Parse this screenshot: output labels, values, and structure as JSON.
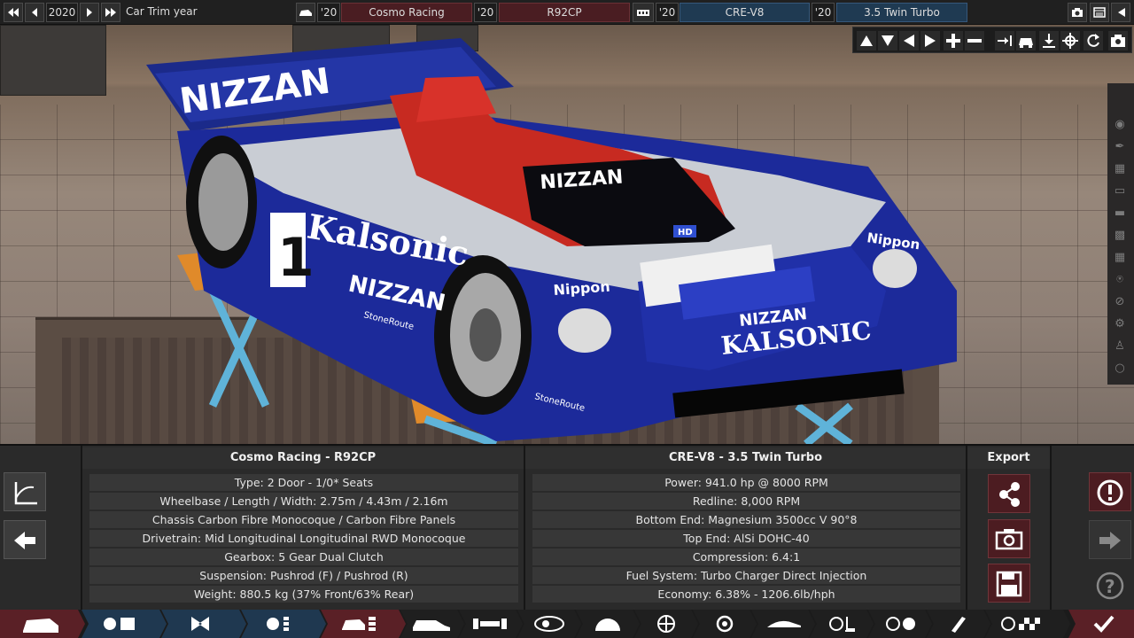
{
  "topbar": {
    "year": "2020",
    "trim_label": "Car Trim year",
    "model_year": "'20",
    "model_name": "Cosmo Racing",
    "trim_year": "'20",
    "trim_name": "R92CP",
    "engine_year": "'20",
    "engine_name": "CRE-V8",
    "variant_year": "'20",
    "variant_name": "3.5 Twin Turbo"
  },
  "car_livery": {
    "wing_text": "NIZZAN",
    "windshield_text": "NIZZAN",
    "sponsor_side": "Kalsonic",
    "brand_side": "NIZZAN",
    "number": "1",
    "brand_nose": "NIZZAN",
    "sponsor_nose": "KALSONIC",
    "tire_left": "Nippon",
    "tire_right": "Nippon",
    "small_1": "StoneRoute",
    "small_2": "StoneRoute",
    "hood_badge": "HD"
  },
  "panel": {
    "car_title": "Cosmo Racing - R92CP",
    "car_specs": [
      "Type: 2 Door - 1/0* Seats",
      "Wheelbase / Length / Width: 2.75m / 4.43m / 2.16m",
      "Chassis Carbon Fibre Monocoque / Carbon Fibre Panels",
      "Drivetrain: Mid Longitudinal Longitudinal RWD Monocoque",
      "Gearbox: 5 Gear Dual Clutch",
      "Suspension: Pushrod (F) / Pushrod (R)",
      "Weight: 880.5 kg (37% Front/63% Rear)"
    ],
    "engine_title": "CRE-V8 - 3.5 Twin Turbo",
    "engine_specs": [
      "Power: 941.0 hp @ 8000 RPM",
      "Redline:  8,000 RPM",
      "Bottom End: Magnesium 3500cc V 90°8",
      "Top End: AlSi DOHC-40",
      "Compression: 6.4:1",
      "Fuel System: Turbo Charger Direct Injection",
      "Economy: 6.38% - 1206.6lb/hph"
    ],
    "export_title": "Export"
  },
  "colors": {
    "accent_red": "#4c1c21",
    "accent_blue": "#1f3a52",
    "nav_blue": "#1f3850",
    "nav_red": "#5a2026"
  }
}
